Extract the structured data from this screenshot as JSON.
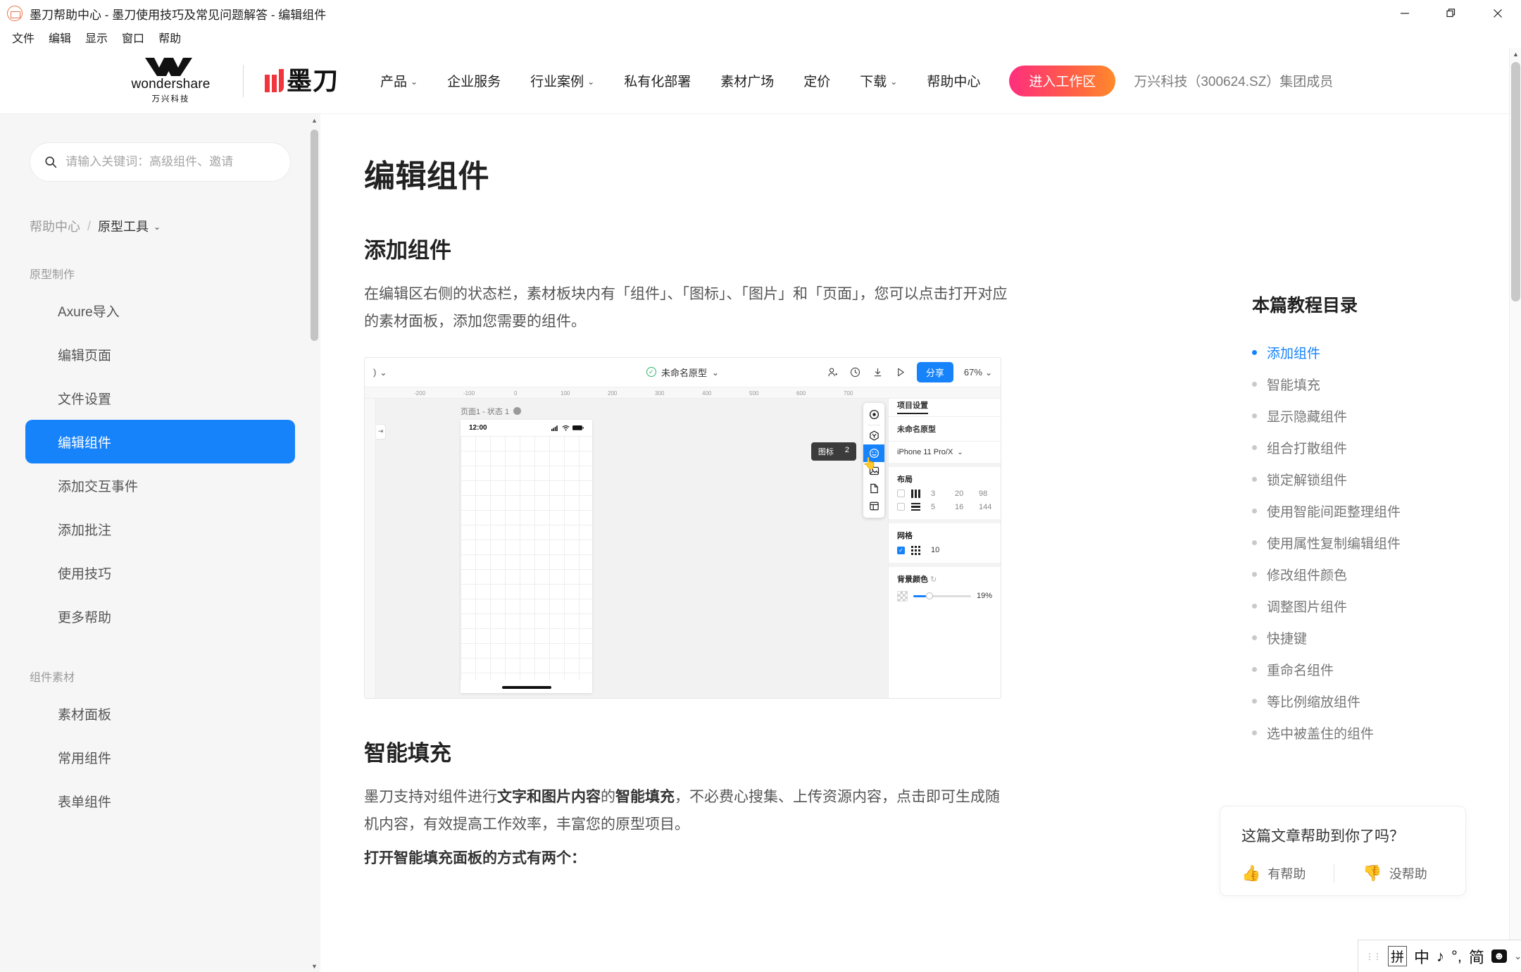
{
  "window": {
    "title": "墨刀帮助中心 - 墨刀使用技巧及常见问题解答 - 编辑组件",
    "favicon": "modao-favicon-icon",
    "controls": {
      "minimize": "—",
      "maximize": "❐",
      "close": "✕"
    }
  },
  "menubar": {
    "items": [
      "文件",
      "编辑",
      "显示",
      "窗口",
      "帮助"
    ]
  },
  "site_header": {
    "brand_wondershare": {
      "word": "wondershare",
      "sub": "万兴科技"
    },
    "brand_modao": "墨刀",
    "nav": [
      {
        "label": "产品",
        "has_caret": true
      },
      {
        "label": "企业服务",
        "has_caret": false
      },
      {
        "label": "行业案例",
        "has_caret": true
      },
      {
        "label": "私有化部署",
        "has_caret": false
      },
      {
        "label": "素材广场",
        "has_caret": false
      },
      {
        "label": "定价",
        "has_caret": false
      },
      {
        "label": "下载",
        "has_caret": true
      },
      {
        "label": "帮助中心",
        "has_caret": false
      }
    ],
    "cta_label": "进入工作区",
    "corp_note": "万兴科技（300624.SZ）集团成员"
  },
  "sidebar": {
    "search_placeholder": "请输入关键词：高级组件、邀请",
    "search_value": "",
    "search_icon": "search-icon",
    "breadcrumb": {
      "root": "帮助中心",
      "separator": "/",
      "current": "原型工具"
    },
    "groups": [
      {
        "title": "原型制作",
        "items": [
          {
            "label": "Axure导入",
            "active": false
          },
          {
            "label": "编辑页面",
            "active": false
          },
          {
            "label": "文件设置",
            "active": false
          },
          {
            "label": "编辑组件",
            "active": true
          },
          {
            "label": "添加交互事件",
            "active": false
          },
          {
            "label": "添加批注",
            "active": false
          },
          {
            "label": "使用技巧",
            "active": false
          },
          {
            "label": "更多帮助",
            "active": false
          }
        ]
      },
      {
        "title": "组件素材",
        "items": [
          {
            "label": "素材面板",
            "active": false
          },
          {
            "label": "常用组件",
            "active": false
          },
          {
            "label": "表单组件",
            "active": false
          }
        ]
      }
    ]
  },
  "article": {
    "title": "编辑组件",
    "section1_heading": "添加组件",
    "section1_paragraph": "在编辑区右侧的状态栏，素材板块内有「组件」、「图标」、「图片」和「页面」，您可以点击打开对应的素材面板，添加您需要的组件。",
    "section2_heading": "智能填充",
    "section2_p_a": "墨刀支持对组件进行",
    "section2_p_b": "文字和图片内容",
    "section2_p_c": "的",
    "section2_p_d": "智能填充",
    "section2_p_e": "，不必费心搜集、上传资源内容，点击即可生成随机内容，有效提高工作效率，丰富您的原型项目。",
    "section2_p_f": "打开智能填充面板的方式有两个："
  },
  "screenshot_app": {
    "topbar": {
      "left_label": ")",
      "doc_name": "未命名原型",
      "status_icon": "check-circle-icon",
      "icons": [
        "add-user-icon",
        "history-icon",
        "download-icon",
        "play-icon"
      ],
      "share_label": "分享",
      "zoom_level": "67%"
    },
    "ruler_ticks": [
      "-200",
      "-100",
      "0",
      "100",
      "200",
      "300",
      "400",
      "500",
      "600",
      "700"
    ],
    "canvas": {
      "page_label": "页面1 - 状态 1",
      "phone_time": "12:00",
      "phone_icons": [
        "signal-icon",
        "wifi-icon",
        "battery-icon"
      ]
    },
    "palette": {
      "tooltip_label": "图标",
      "tooltip_shortcut": "2",
      "icons": [
        "target-icon",
        "component-icon",
        "smiley-icon",
        "image-icon",
        "page-icon",
        "layout-icon"
      ],
      "selected_index": 2
    },
    "inspector": {
      "tab_label": "项目设置",
      "project_name": "未命名原型",
      "device": "iPhone 11 Pro/X",
      "layout_title": "布局",
      "layout_rows": [
        {
          "checked": false,
          "icon": "columns-icon",
          "count": "3",
          "gutter": "20",
          "width": "98"
        },
        {
          "checked": false,
          "icon": "rows-icon",
          "count": "5",
          "gutter": "16",
          "width": "144"
        }
      ],
      "grid_title": "网格",
      "grid_row": {
        "checked": true,
        "icon": "grid-dots-icon",
        "size": "10"
      },
      "bg_title": "背景颜色",
      "bg_reset_icon": "reset-icon",
      "bg_opacity": "19%"
    }
  },
  "toc": {
    "title": "本篇教程目录",
    "items": [
      {
        "label": "添加组件",
        "active": true
      },
      {
        "label": "智能填充",
        "active": false
      },
      {
        "label": "显示隐藏组件",
        "active": false
      },
      {
        "label": "组合打散组件",
        "active": false
      },
      {
        "label": "锁定解锁组件",
        "active": false
      },
      {
        "label": "使用智能间距整理组件",
        "active": false
      },
      {
        "label": "使用属性复制编辑组件",
        "active": false
      },
      {
        "label": "修改组件颜色",
        "active": false
      },
      {
        "label": "调整图片组件",
        "active": false
      },
      {
        "label": "快捷键",
        "active": false
      },
      {
        "label": "重命名组件",
        "active": false
      },
      {
        "label": "等比例缩放组件",
        "active": false
      },
      {
        "label": "选中被盖住的组件",
        "active": false
      }
    ]
  },
  "feedback": {
    "question": "这篇文章帮助到你了吗？",
    "yes_label": "有帮助",
    "no_label": "没帮助",
    "yes_icon": "thumbs-up-icon",
    "no_icon": "thumbs-down-icon"
  },
  "ime_tray": {
    "mode_key": "拼",
    "lang": "中",
    "music": "♪",
    "punct": "°,",
    "script": "简",
    "emoji_icon": "emoji-icon",
    "expand_icon": "chevron-down-icon"
  },
  "colors": {
    "accent_blue": "#1683fb",
    "cta_gradient_start": "#ff2e7e",
    "cta_gradient_end": "#ff8a2b",
    "sidebar_bg": "#f6f6f6",
    "logo_red": "#f0353d"
  }
}
